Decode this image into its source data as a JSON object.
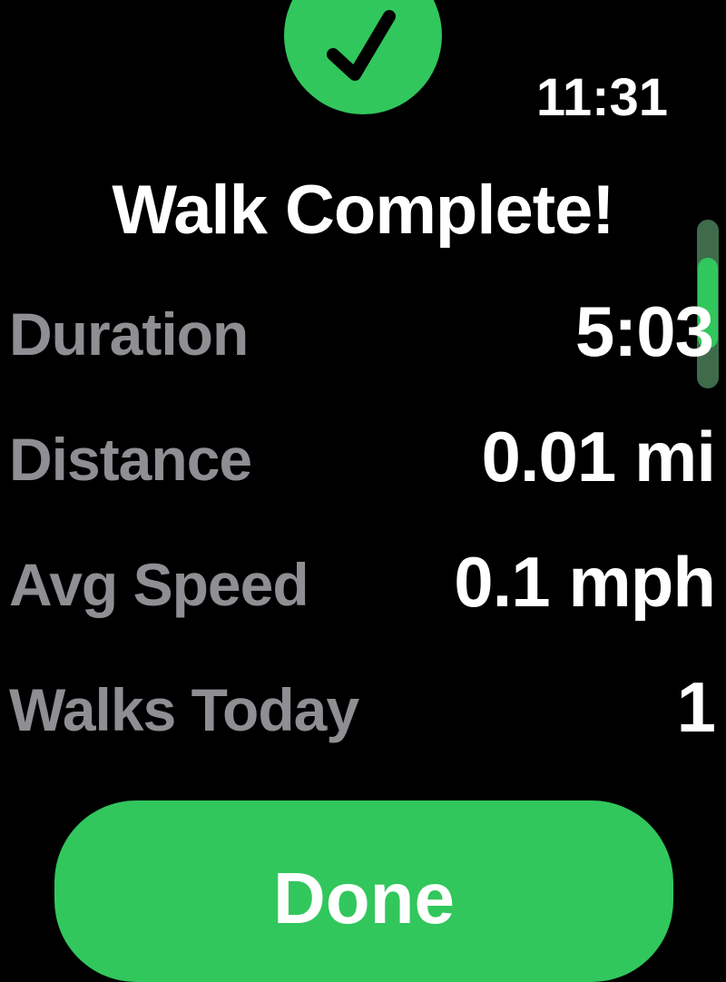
{
  "status_bar": {
    "time": "11:31"
  },
  "badge": {
    "icon": "checkmark-icon",
    "color": "#31c75c"
  },
  "title": "Walk Complete!",
  "stats": [
    {
      "label": "Duration",
      "value": "5:03"
    },
    {
      "label": "Distance",
      "value": "0.01 mi"
    },
    {
      "label": "Avg Speed",
      "value": "0.1 mph"
    },
    {
      "label": "Walks Today",
      "value": "1"
    }
  ],
  "actions": {
    "done_label": "Done"
  },
  "colors": {
    "accent": "#31c75c",
    "label": "#8e8e93",
    "background": "#000000"
  }
}
